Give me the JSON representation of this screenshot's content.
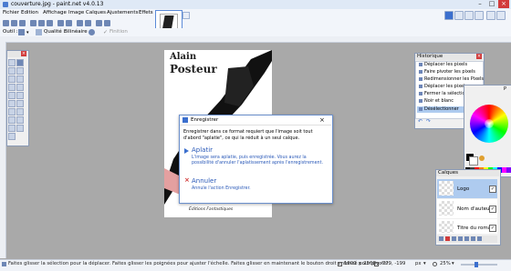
{
  "window": {
    "title": "couverture.jpg - paint.net v4.0.13"
  },
  "menu": [
    "Fichier",
    "Edition",
    "Affichage",
    "Image",
    "Calques",
    "Ajustements",
    "Effets"
  ],
  "toolbar": {
    "tool_label": "Outil :",
    "quality_label": "Qualité :",
    "quality_value": "Bilinéaire",
    "finish_label": "Finition"
  },
  "canvas": {
    "title_line1": "Alain",
    "title_line2": "Posteur",
    "publisher_logo_text": "Éditions Fantastiques"
  },
  "dialog": {
    "title": "Enregistrer",
    "message": "Enregistrer dans ce format requiert que l'image soit tout d'abord \"aplatie\", ce qui la réduit à un seul calque.",
    "option1": {
      "title": "Aplatir",
      "description": "L'image sera aplatie, puis enregistrée. Vous aurez la possibilité d'annuler l'aplatissement après l'enregistrement."
    },
    "option2": {
      "title": "Annuler",
      "description": "Annule l'action Enregistrer."
    }
  },
  "history": {
    "title": "Historique",
    "items": [
      "Déplacer les pixels",
      "Faire pivoter les pixels",
      "Redimensionner les Pixels",
      "Déplacer les pixels",
      "Fermer la sélection",
      "Noir et blanc",
      "Désélectionner"
    ],
    "selected_index": 6
  },
  "layers": {
    "title": "Calques",
    "items": [
      "Logo",
      "Nom d'auteur",
      "Titre du roman"
    ]
  },
  "colors": {
    "title": "Couleurs",
    "palette": [
      "#000000",
      "#404040",
      "#ff0000",
      "#ff8000",
      "#ffff00",
      "#00ff00",
      "#00ffff",
      "#0000ff",
      "#ff00ff",
      "#8000ff",
      "#ffffff"
    ]
  },
  "status": {
    "hint": "Faites glisser la sélection pour la déplacer. Faites glisser les poignées pour ajuster l'échelle. Faites glisser en maintenant le bouton droit enfoncé pour pivoter.",
    "image_size": "1600 × 2560",
    "cursor": "-779, -199",
    "units": "px",
    "zoom": "25%"
  }
}
